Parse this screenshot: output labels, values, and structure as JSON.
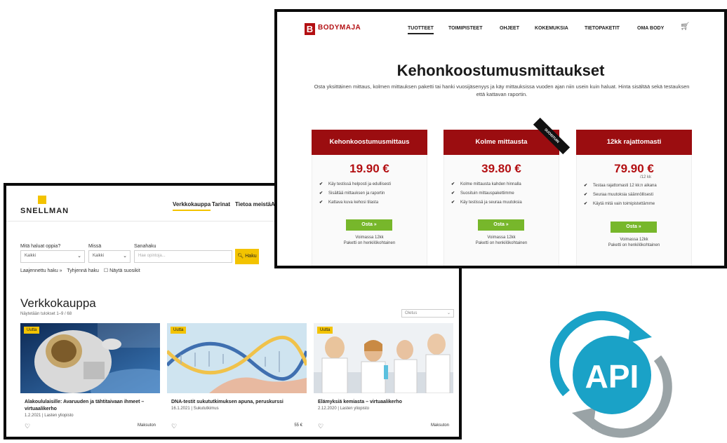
{
  "snellman": {
    "logo": "SNELLMAN",
    "nav": [
      "Verkkokauppa",
      "Tarinat",
      "Tietoa meistä",
      "As"
    ],
    "filters": {
      "what_label": "Mitä haluat oppia?",
      "what_value": "Kaikki",
      "where_label": "Missä",
      "where_value": "Kaikki",
      "keyword_label": "Sanahaku",
      "keyword_placeholder": "Hae opintoja...",
      "search_button": "Haku",
      "options": [
        "Laajennettu haku »",
        "Tyhjennä haku",
        "☐ Näytä suosikit"
      ]
    },
    "section_title": "Verkkokauppa",
    "results": "Näytetään tulokset 1–9 / 68",
    "sort": "Oletus",
    "cards": [
      {
        "badge": "Uutta",
        "title": "Alakoululaisille: Avaruuden ja tähtitaivaan ihmeet – virtuaalikerho",
        "meta": "1.2.2021 | Lasten yliopisto",
        "price": "Maksuton"
      },
      {
        "badge": "Uutta",
        "title": "DNA-testit sukututkimuksen apuna, peruskurssi",
        "meta": "16.1.2021 | Sukututkimus",
        "price": "55 €"
      },
      {
        "badge": "Uutta",
        "title": "Elämyksiä kemiasta – virtuaalikerho",
        "meta": "2.12.2020 | Lasten yliopisto",
        "price": "Maksuton"
      }
    ]
  },
  "bodymaja": {
    "logo_letter": "B",
    "logo": "BODYMAJA",
    "nav": [
      "TUOTTEET",
      "TOIMIPISTEET",
      "OHJEET",
      "KOKEMUKSIA",
      "TIETOPAKETIT",
      "OMA BODY"
    ],
    "title": "Kehonkoostumusmittaukset",
    "intro": "Osta yksittäinen mittaus, kolmen mittauksen paketti tai hanki vuosijäsenyys ja käy mittauksissa vuoden ajan niin usein kuin haluat. Hinta sisältää sekä testauksen että kattavan raportin.",
    "ribbon": "SUOSITUIN",
    "cards": [
      {
        "name": "Kehonkoostumusmittaus",
        "price": "19.90 €",
        "note": "",
        "features": [
          "Käy testissä helposti ja edullisesti",
          "Sisältää mittauksen ja raportin",
          "Kattava kuva kehosi tilasta"
        ],
        "buy": "Osta »",
        "valid": "Voimassa 12kk",
        "personal": "Paketti on henkilökohtainen"
      },
      {
        "name": "Kolme mittausta",
        "price": "39.80 €",
        "note": "",
        "features": [
          "Kolme mittausta kahden hinnalla",
          "Suosituin mittauspakettimme",
          "Käy testissä ja seuraa muutoksia"
        ],
        "buy": "Osta »",
        "valid": "Voimassa 12kk",
        "personal": "Paketti on henkilökohtainen"
      },
      {
        "name": "12kk rajattomasti",
        "price": "79.90 €",
        "note": "/12 kk",
        "features": [
          "Testaa rajattomasti 12 kk:n aikana",
          "Seuraa muutoksia säännöllisesti",
          "Käytä mitä vain toimipistettämme"
        ],
        "buy": "Osta »",
        "valid": "Voimassa 12kk",
        "personal": "Paketti on henkilökohtainen"
      }
    ]
  },
  "api_logo": {
    "text": "API",
    "colors": {
      "blue": "#1aa2c7",
      "grey": "#9aa3a6"
    }
  }
}
